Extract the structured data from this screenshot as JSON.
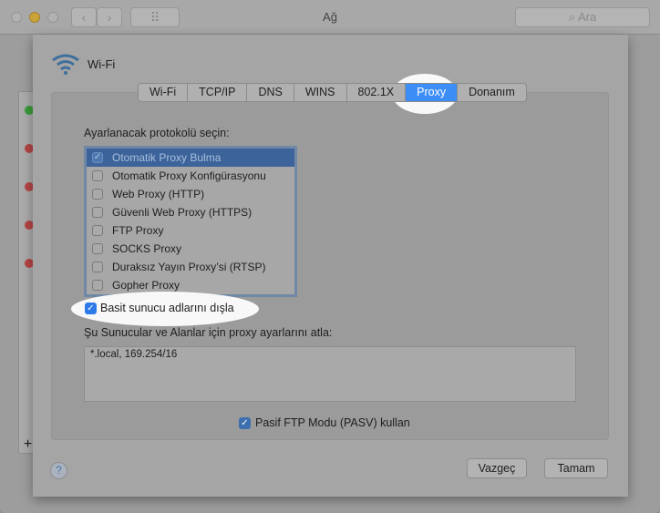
{
  "window": {
    "title": "Ağ",
    "search_placeholder": "Ara",
    "back": "‹",
    "forward": "›",
    "grid": "⠿"
  },
  "sheet": {
    "service": "Wi-Fi",
    "tabs": [
      {
        "label": "Wi-Fi"
      },
      {
        "label": "TCP/IP"
      },
      {
        "label": "DNS"
      },
      {
        "label": "WINS"
      },
      {
        "label": "802.1X"
      },
      {
        "label": "Proxy",
        "selected": true
      },
      {
        "label": "Donanım"
      }
    ],
    "protocol_label": "Ayarlanacak protokolü seçin:",
    "protocols": [
      {
        "label": "Otomatik Proxy Bulma",
        "checked": true,
        "selected": true
      },
      {
        "label": "Otomatik Proxy Konfigürasyonu",
        "checked": false
      },
      {
        "label": "Web Proxy (HTTP)",
        "checked": false
      },
      {
        "label": "Güvenli Web Proxy (HTTPS)",
        "checked": false
      },
      {
        "label": "FTP Proxy",
        "checked": false
      },
      {
        "label": "SOCKS Proxy",
        "checked": false
      },
      {
        "label": "Duraksız Yayın Proxy’si (RTSP)",
        "checked": false
      },
      {
        "label": "Gopher Proxy",
        "checked": false
      }
    ],
    "exclude_simple": {
      "label": "Basit sunucu adlarını dışla",
      "checked": true
    },
    "bypass_label": "Şu Sunucular ve Alanlar için proxy ayarlarını atla:",
    "bypass_value": "*.local, 169.254/16",
    "passive_ftp": {
      "label": "Pasif FTP Modu (PASV) kullan",
      "checked": true
    },
    "help": "?",
    "cancel": "Vazgeç",
    "ok": "Tamam"
  },
  "sidebar": {
    "add": "+"
  },
  "check_mark": "✓"
}
